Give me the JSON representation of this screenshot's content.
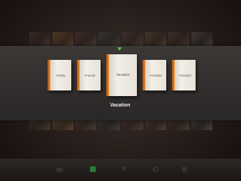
{
  "header": {
    "caption": ""
  },
  "books": [
    {
      "label": "Family"
    },
    {
      "label": "Friends"
    },
    {
      "label": "Vacation",
      "selected": true
    },
    {
      "label": "Friends2"
    },
    {
      "label": "Friends3"
    }
  ],
  "selected_title": "Vacation",
  "toolbar": {
    "icons": [
      "film-icon",
      "square-icon",
      "close-icon",
      "gear-icon",
      "grid-icon"
    ]
  },
  "colors": {
    "accent_spine": "#d8771e",
    "selector_arrow": "#5cc84a",
    "band": "#3b3836",
    "background": "#1a1210"
  }
}
